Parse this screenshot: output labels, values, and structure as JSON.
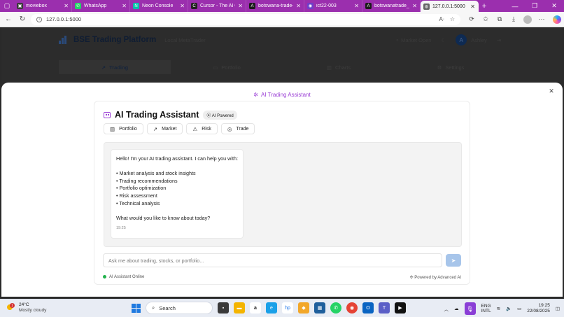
{
  "browser": {
    "tabs": [
      {
        "title": "moviebox",
        "favicon_color": "#3a3a3a",
        "glyph": "▣"
      },
      {
        "title": "WhatsApp",
        "favicon_color": "#25d366",
        "glyph": "✆"
      },
      {
        "title": "Neon Console",
        "favicon_color": "#00c2a8",
        "glyph": "N"
      },
      {
        "title": "Cursor - The AI Co",
        "favicon_color": "#222222",
        "glyph": "C"
      },
      {
        "title": "botswana-trade-d",
        "favicon_color": "#1b1b1b",
        "glyph": "A"
      },
      {
        "title": "ict22-003",
        "favicon_color": "#6e40c9",
        "glyph": "◉"
      },
      {
        "title": "botswanatrade_tra",
        "favicon_color": "#1b1b1b",
        "glyph": "A"
      },
      {
        "title": "127.0.0.1:5000",
        "favicon_color": "#666666",
        "glyph": "◍"
      }
    ],
    "active_tab_index": 7,
    "url": "127.0.0.1:5000",
    "accent_color": "#9b2fae"
  },
  "app": {
    "title": "BSE Trading Platform",
    "subtitle": "Local MetaTrader",
    "market_status": "Market Open",
    "user_initial": "A",
    "user_name": "Ashley",
    "nav": [
      {
        "label": "Trading",
        "icon": "trend-up-icon",
        "glyph": "↗"
      },
      {
        "label": "Portfolio",
        "icon": "briefcase-icon",
        "glyph": "▭"
      },
      {
        "label": "Charts",
        "icon": "bar-chart-icon",
        "glyph": "▥"
      },
      {
        "label": "Settings",
        "icon": "gear-icon",
        "glyph": "⚙"
      }
    ]
  },
  "modal": {
    "title": "AI Trading Assistant",
    "card_title": "AI Trading Assistant",
    "badge": "AI Powered",
    "quick_actions": [
      {
        "label": "Portfolio",
        "icon": "bar-chart-icon",
        "glyph": "▥"
      },
      {
        "label": "Market",
        "icon": "trend-up-icon",
        "glyph": "↗"
      },
      {
        "label": "Risk",
        "icon": "warning-icon",
        "glyph": "⚠"
      },
      {
        "label": "Trade",
        "icon": "target-icon",
        "glyph": "◎"
      }
    ],
    "message": {
      "greeting": "Hello! I'm your AI trading assistant. I can help you with:",
      "bullets": [
        "• Market analysis and stock insights",
        "• Trading recommendations",
        "• Portfolio optimization",
        "• Risk assessment",
        "• Technical analysis"
      ],
      "question": "What would you like to know about today?",
      "time": "19:25"
    },
    "input_placeholder": "Ask me about trading, stocks, or portfolio...",
    "status": "AI Assistant Online",
    "powered_by": "Powered by Advanced AI"
  },
  "taskbar": {
    "weather_temp": "24°C",
    "weather_desc": "Mostly cloudy",
    "weather_badge": "1",
    "search_label": "Search",
    "lang_top": "ENG",
    "lang_bottom": "INTL",
    "time": "19:25",
    "date": "22/08/2025"
  }
}
